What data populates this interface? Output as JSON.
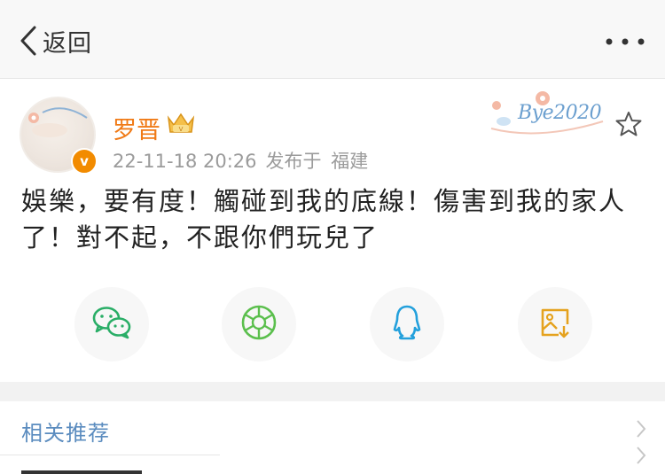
{
  "nav": {
    "back_label": "返回"
  },
  "post": {
    "username": "罗晋",
    "time": "22-11-18 20:26",
    "source_prefix": "发布于",
    "location": "福建",
    "deco_text": "Bye2020",
    "text": "娛樂，要有度！觸碰到我的底線！傷害到我的家人了！對不起，不跟你們玩兒了",
    "verified_mark": "v"
  },
  "share": [
    "wechat-icon",
    "moments-icon",
    "qq-icon",
    "save-image-icon"
  ],
  "related": {
    "title": "相关推荐"
  },
  "colors": {
    "username": "#f07a16",
    "link": "#5b8cbf",
    "badge": "#f28b00",
    "wechat": "#2aae67",
    "qq": "#23a0dc",
    "save": "#e5a21e"
  }
}
